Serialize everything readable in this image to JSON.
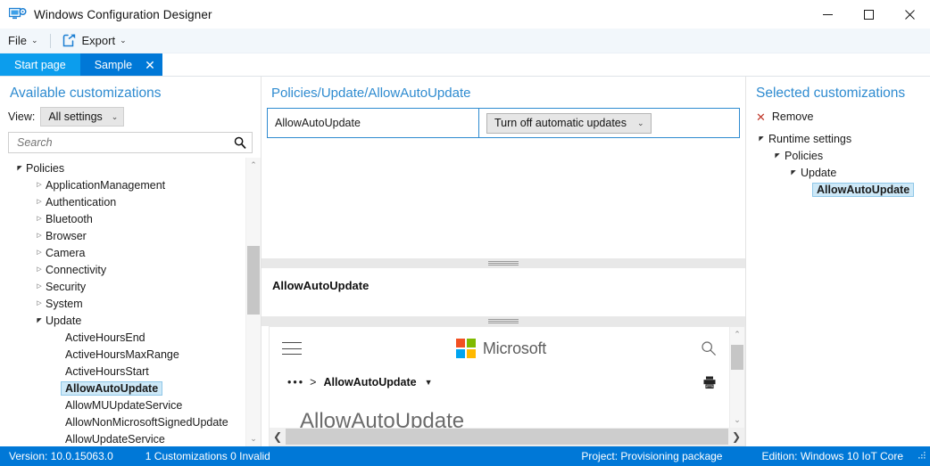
{
  "window": {
    "title": "Windows Configuration Designer",
    "icon": "app-designer-icon",
    "minimize": "—",
    "maximize": "□",
    "close": "✕"
  },
  "menubar": {
    "items": [
      {
        "label": "File",
        "icon": null,
        "caret": "⌄"
      },
      {
        "label": "Export",
        "icon": "export-icon",
        "caret": "⌄"
      }
    ]
  },
  "tabs": [
    {
      "label": "Start page",
      "closable": false
    },
    {
      "label": "Sample",
      "closable": true,
      "close": "✕"
    }
  ],
  "left_panel": {
    "title": "Available customizations",
    "view_label": "View:",
    "view_value": "All settings",
    "view_caret": "⌄",
    "search_placeholder": "Search",
    "search_value": "",
    "search_icon": "search-icon",
    "tree": [
      {
        "label": "Policies",
        "indent": 0,
        "state": "expanded",
        "selected": false
      },
      {
        "label": "ApplicationManagement",
        "indent": 1,
        "state": "collapsed",
        "selected": false
      },
      {
        "label": "Authentication",
        "indent": 1,
        "state": "collapsed",
        "selected": false
      },
      {
        "label": "Bluetooth",
        "indent": 1,
        "state": "collapsed",
        "selected": false
      },
      {
        "label": "Browser",
        "indent": 1,
        "state": "collapsed",
        "selected": false
      },
      {
        "label": "Camera",
        "indent": 1,
        "state": "collapsed",
        "selected": false
      },
      {
        "label": "Connectivity",
        "indent": 1,
        "state": "collapsed",
        "selected": false
      },
      {
        "label": "Security",
        "indent": 1,
        "state": "collapsed",
        "selected": false
      },
      {
        "label": "System",
        "indent": 1,
        "state": "collapsed",
        "selected": false
      },
      {
        "label": "Update",
        "indent": 1,
        "state": "expanded",
        "selected": false
      },
      {
        "label": "ActiveHoursEnd",
        "indent": 2,
        "state": "leaf",
        "selected": false
      },
      {
        "label": "ActiveHoursMaxRange",
        "indent": 2,
        "state": "leaf",
        "selected": false
      },
      {
        "label": "ActiveHoursStart",
        "indent": 2,
        "state": "leaf",
        "selected": false
      },
      {
        "label": "AllowAutoUpdate",
        "indent": 2,
        "state": "leaf",
        "selected": true
      },
      {
        "label": "AllowMUUpdateService",
        "indent": 2,
        "state": "leaf",
        "selected": false
      },
      {
        "label": "AllowNonMicrosoftSignedUpdate",
        "indent": 2,
        "state": "leaf",
        "selected": false
      },
      {
        "label": "AllowUpdateService",
        "indent": 2,
        "state": "leaf",
        "selected": false
      }
    ],
    "scroll_up": "⌃",
    "scroll_down": "⌄"
  },
  "center_panel": {
    "breadcrumb": "Policies/Update/AllowAutoUpdate",
    "setting_name": "AllowAutoUpdate",
    "setting_value": "Turn off automatic updates",
    "value_caret": "⌄",
    "description_title": "AllowAutoUpdate",
    "preview": {
      "menu_icon": "hamburger-icon",
      "brand": "Microsoft",
      "search_icon": "search-icon",
      "crumb_dots": "•••",
      "crumb_sep": ">",
      "crumb_current": "AllowAutoUpdate",
      "crumb_caret": "▼",
      "print_icon": "printer-icon",
      "heading": "AllowAutoUpdate",
      "scroll_up": "⌃",
      "scroll_down": "⌄",
      "scroll_left": "❮",
      "scroll_right": "❯"
    }
  },
  "right_panel": {
    "title": "Selected customizations",
    "remove_label": "Remove",
    "remove_icon": "remove-x-icon",
    "tree": [
      {
        "label": "Runtime settings",
        "indent": 0,
        "state": "expanded",
        "selected": false
      },
      {
        "label": "Policies",
        "indent": 1,
        "state": "expanded",
        "selected": false
      },
      {
        "label": "Update",
        "indent": 2,
        "state": "expanded",
        "selected": false
      },
      {
        "label": "AllowAutoUpdate",
        "indent": 3,
        "state": "leaf",
        "selected": true
      }
    ]
  },
  "status_bar": {
    "version": "Version: 10.0.15063.0",
    "customizations": "1 Customizations 0 Invalid",
    "project": "Project: Provisioning package",
    "edition": "Edition: Windows 10 IoT Core"
  },
  "colors": {
    "accent": "#0078d7",
    "tab_active": "#0c9ded",
    "link": "#2e8bd0",
    "selection": "#cde8f7",
    "remove_x": "#c0392b"
  }
}
